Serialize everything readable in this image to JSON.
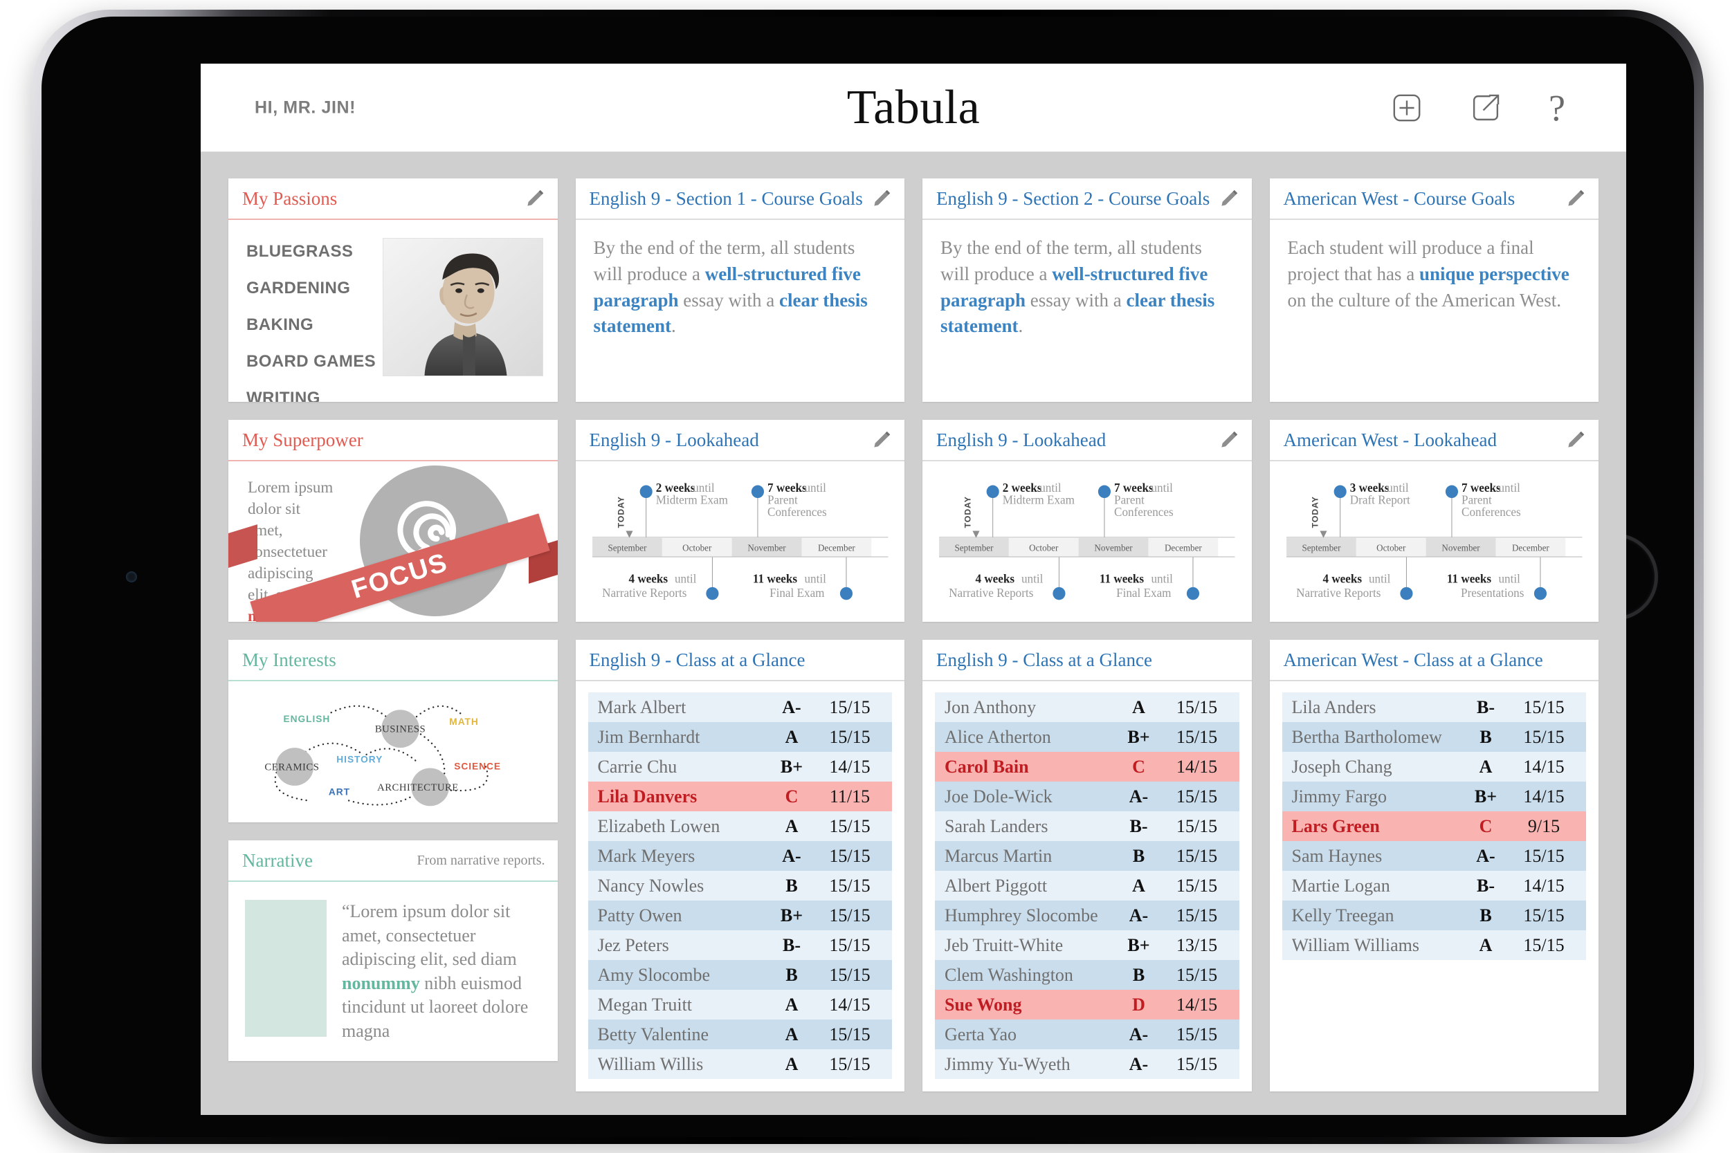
{
  "app": {
    "greeting": "HI, MR. JIN!",
    "title": "Tabula",
    "actions": {
      "add": "add-icon",
      "share": "share-icon",
      "help": "?"
    }
  },
  "cards": {
    "passions": {
      "title": "My Passions",
      "edit": "edit-pencil",
      "items": [
        "BLUEGRASS",
        "GARDENING",
        "BAKING",
        "BOARD GAMES",
        "WRITING"
      ]
    },
    "goals_eng1": {
      "title": "English 9 - Section 1 - Course Goals",
      "edit": "edit-pencil",
      "text_1": "By the end of the term, all students will produce a ",
      "bold_1": "well-structured five paragraph",
      "text_2": " essay with a ",
      "bold_2": "clear thesis statement",
      "text_3": "."
    },
    "goals_eng2": {
      "title": "English 9 - Section 2 - Course Goals",
      "edit": "edit-pencil",
      "text_1": "By the end of the term, all students will produce a ",
      "bold_1": "well-structured five paragraph",
      "text_2": " essay with a ",
      "bold_2": "clear thesis statement",
      "text_3": "."
    },
    "goals_west": {
      "title": "American West - Course Goals",
      "edit": "edit-pencil",
      "text_1": "Each student will produce a final project that has a ",
      "bold_1": "unique perspective",
      "text_2": " on the culture of the American West.",
      "bold_2": "",
      "text_3": ""
    },
    "superpower": {
      "title": "My Superpower",
      "text_1": "Lorem ipsum dolor sit amet, consectetuer adipiscing elit, sed diam ",
      "bold_1": "nonummy",
      "banner": "FOCUS"
    },
    "interests": {
      "title": "My Interests",
      "nodes": [
        {
          "label": "BUSINESS",
          "kind": "circle"
        },
        {
          "label": "CERAMICS",
          "kind": "circle"
        },
        {
          "label": "ARCHITECTURE",
          "kind": "circle"
        },
        {
          "label": "ENGLISH",
          "kind": "text",
          "color": "#63b79f"
        },
        {
          "label": "MATH",
          "kind": "text",
          "color": "#e2b53c"
        },
        {
          "label": "HISTORY",
          "kind": "text",
          "color": "#63acd8"
        },
        {
          "label": "SCIENCE",
          "kind": "text",
          "color": "#e05a42"
        },
        {
          "label": "ART",
          "kind": "text",
          "color": "#3b72b8"
        }
      ]
    },
    "narrative": {
      "title": "Narrative",
      "note": "From narrative reports.",
      "text_1": "“Lorem ipsum dolor sit amet, consectetuer adipiscing elit, sed diam ",
      "bold_1": "nonummy",
      "text_2": " nibh euismod tincidunt ut laoreet dolore magna"
    }
  },
  "lookaheads": [
    {
      "title": "English 9 - Lookahead",
      "edit": "edit-pencil",
      "today_label": "TODAY",
      "months": [
        "September",
        "October",
        "November",
        "December"
      ],
      "events_above": [
        {
          "weeks": "2 weeks",
          "until": "until",
          "name": "Midterm Exam"
        },
        {
          "weeks": "7 weeks",
          "until": "until",
          "name": "Parent Conferences"
        }
      ],
      "events_below": [
        {
          "weeks": "4 weeks",
          "until": "until",
          "name": "Narrative Reports"
        },
        {
          "weeks": "11 weeks",
          "until": "until",
          "name": "Final Exam"
        }
      ]
    },
    {
      "title": "English 9 - Lookahead",
      "edit": "edit-pencil",
      "today_label": "TODAY",
      "months": [
        "September",
        "October",
        "November",
        "December"
      ],
      "events_above": [
        {
          "weeks": "2 weeks",
          "until": "until",
          "name": "Midterm Exam"
        },
        {
          "weeks": "7 weeks",
          "until": "until",
          "name": "Parent Conferences"
        }
      ],
      "events_below": [
        {
          "weeks": "4 weeks",
          "until": "until",
          "name": "Narrative Reports"
        },
        {
          "weeks": "11 weeks",
          "until": "until",
          "name": "Final Exam"
        }
      ]
    },
    {
      "title": "American West - Lookahead",
      "edit": "edit-pencil",
      "today_label": "TODAY",
      "months": [
        "September",
        "October",
        "November",
        "December"
      ],
      "events_above": [
        {
          "weeks": "3 weeks",
          "until": "until",
          "name": "Draft Report"
        },
        {
          "weeks": "7 weeks",
          "until": "until",
          "name": "Parent Conferences"
        }
      ],
      "events_below": [
        {
          "weeks": "4 weeks",
          "until": "until",
          "name": "Narrative Reports"
        },
        {
          "weeks": "11 weeks",
          "until": "until",
          "name": "Presentations"
        }
      ]
    }
  ],
  "rosters": [
    {
      "title": "English 9 - Class at a Glance",
      "rows": [
        {
          "name": "Mark Albert",
          "grade": "A-",
          "score": "15/15",
          "alert": false
        },
        {
          "name": "Jim Bernhardt",
          "grade": "A",
          "score": "15/15",
          "alert": false
        },
        {
          "name": "Carrie Chu",
          "grade": "B+",
          "score": "14/15",
          "alert": false
        },
        {
          "name": "Lila Danvers",
          "grade": "C",
          "score": "11/15",
          "alert": true
        },
        {
          "name": "Elizabeth Lowen",
          "grade": "A",
          "score": "15/15",
          "alert": false
        },
        {
          "name": "Mark Meyers",
          "grade": "A-",
          "score": "15/15",
          "alert": false
        },
        {
          "name": "Nancy Nowles",
          "grade": "B",
          "score": "15/15",
          "alert": false
        },
        {
          "name": "Patty Owen",
          "grade": "B+",
          "score": "15/15",
          "alert": false
        },
        {
          "name": "Jez Peters",
          "grade": "B-",
          "score": "15/15",
          "alert": false
        },
        {
          "name": "Amy Slocombe",
          "grade": "B",
          "score": "15/15",
          "alert": false
        },
        {
          "name": "Megan Truitt",
          "grade": "A",
          "score": "14/15",
          "alert": false
        },
        {
          "name": "Betty Valentine",
          "grade": "A",
          "score": "15/15",
          "alert": false
        },
        {
          "name": "William Willis",
          "grade": "A",
          "score": "15/15",
          "alert": false
        }
      ]
    },
    {
      "title": "English 9 - Class at a Glance",
      "rows": [
        {
          "name": "Jon Anthony",
          "grade": "A",
          "score": "15/15",
          "alert": false
        },
        {
          "name": "Alice Atherton",
          "grade": "B+",
          "score": "15/15",
          "alert": false
        },
        {
          "name": "Carol Bain",
          "grade": "C",
          "score": "14/15",
          "alert": true
        },
        {
          "name": "Joe Dole-Wick",
          "grade": "A-",
          "score": "15/15",
          "alert": false
        },
        {
          "name": "Sarah Landers",
          "grade": "B-",
          "score": "15/15",
          "alert": false
        },
        {
          "name": "Marcus Martin",
          "grade": "B",
          "score": "15/15",
          "alert": false
        },
        {
          "name": "Albert Piggott",
          "grade": "A",
          "score": "15/15",
          "alert": false
        },
        {
          "name": "Humphrey Slocombe",
          "grade": "A-",
          "score": "15/15",
          "alert": false
        },
        {
          "name": "Jeb Truitt-White",
          "grade": "B+",
          "score": "13/15",
          "alert": false
        },
        {
          "name": "Clem Washington",
          "grade": "B",
          "score": "15/15",
          "alert": false
        },
        {
          "name": "Sue Wong",
          "grade": "D",
          "score": "14/15",
          "alert": true
        },
        {
          "name": "Gerta Yao",
          "grade": "A-",
          "score": "15/15",
          "alert": false
        },
        {
          "name": "Jimmy Yu-Wyeth",
          "grade": "A-",
          "score": "15/15",
          "alert": false
        }
      ]
    },
    {
      "title": "American West - Class at a Glance",
      "rows": [
        {
          "name": "Lila Anders",
          "grade": "B-",
          "score": "15/15",
          "alert": false
        },
        {
          "name": "Bertha Bartholomew",
          "grade": "B",
          "score": "15/15",
          "alert": false
        },
        {
          "name": "Joseph Chang",
          "grade": "A",
          "score": "14/15",
          "alert": false
        },
        {
          "name": "Jimmy Fargo",
          "grade": "B+",
          "score": "14/15",
          "alert": false
        },
        {
          "name": "Lars Green",
          "grade": "C",
          "score": "9/15",
          "alert": true
        },
        {
          "name": "Sam Haynes",
          "grade": "A-",
          "score": "15/15",
          "alert": false
        },
        {
          "name": "Martie Logan",
          "grade": "B-",
          "score": "14/15",
          "alert": false
        },
        {
          "name": "Kelly Treegan",
          "grade": "B",
          "score": "15/15",
          "alert": false
        },
        {
          "name": "William Williams",
          "grade": "A",
          "score": "15/15",
          "alert": false
        }
      ]
    }
  ],
  "colors": {
    "red": "#e15b52",
    "blue": "#2e74b5",
    "teal": "#63b79f",
    "alert_row": "#f9b4b2",
    "row_even": "#e8f0f8",
    "row_odd": "#c9ddec",
    "timeline_dot": "#3b7fbf",
    "screen_bg": "#cfcfcf"
  }
}
